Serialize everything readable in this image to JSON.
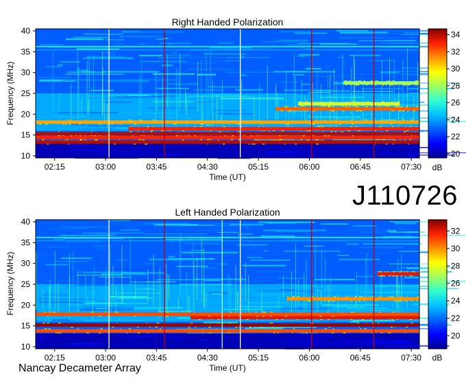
{
  "observation_id": "J110726",
  "credit": "Nancay Decameter Array",
  "colormap": [
    "#00008f",
    "#0000ff",
    "#0060ff",
    "#00c0ff",
    "#30ffd0",
    "#a0ff60",
    "#ffff00",
    "#ff9000",
    "#ff2000",
    "#800000"
  ],
  "chart_data": [
    {
      "type": "heatmap",
      "title": "Right Handed Polarization",
      "xlabel": "Time (UT)",
      "ylabel": "Frequency (MHz)",
      "x_ticks": [
        "02:15",
        "03:00",
        "03:45",
        "04:30",
        "05:15",
        "06:00",
        "06:45",
        "07:30"
      ],
      "x_tick_hours": [
        2.25,
        3.0,
        3.75,
        4.5,
        5.25,
        6.0,
        6.75,
        7.5
      ],
      "xlim_hours": [
        1.97,
        7.62
      ],
      "y_ticks": [
        10,
        15,
        20,
        25,
        30,
        35,
        40
      ],
      "ylim": [
        9.5,
        40.5
      ],
      "colorbar": {
        "unit": "dB",
        "ticks": [
          20,
          22,
          24,
          26,
          28,
          30,
          32,
          34
        ],
        "range": [
          19.5,
          34.7
        ]
      },
      "emission_bands": [
        {
          "freq_mhz": 13.3,
          "start": "01:58",
          "end": "07:37",
          "db": 34
        },
        {
          "freq_mhz": 14.4,
          "start": "01:58",
          "end": "07:37",
          "db": 33
        },
        {
          "freq_mhz": 15.3,
          "start": "01:58",
          "end": "07:37",
          "db": 34
        },
        {
          "freq_mhz": 16.5,
          "start": "03:20",
          "end": "07:37",
          "db": 33
        },
        {
          "freq_mhz": 18.1,
          "start": "01:58",
          "end": "07:37",
          "db": 31
        },
        {
          "freq_mhz": 21.3,
          "start": "05:30",
          "end": "07:37",
          "db": 32
        },
        {
          "freq_mhz": 22.5,
          "start": "05:50",
          "end": "07:20",
          "db": 29
        },
        {
          "freq_mhz": 27.5,
          "start": "06:30",
          "end": "07:37",
          "db": 28
        }
      ],
      "vertical_lines": [
        {
          "time": "03:03",
          "color": "#ffffa0"
        },
        {
          "time": "03:52",
          "color": "#c00000"
        },
        {
          "time": "04:59",
          "color": "#ffffff"
        },
        {
          "time": "06:02",
          "color": "#c00000"
        },
        {
          "time": "06:57",
          "color": "#c00000"
        }
      ]
    },
    {
      "type": "heatmap",
      "title": "Left Handed Polarization",
      "xlabel": "Time (UT)",
      "ylabel": "Frequency (MHz)",
      "x_ticks": [
        "02:15",
        "03:00",
        "03:45",
        "04:30",
        "05:15",
        "06:00",
        "06:45",
        "07:30"
      ],
      "x_tick_hours": [
        2.25,
        3.0,
        3.75,
        4.5,
        5.25,
        6.0,
        6.75,
        7.5
      ],
      "xlim_hours": [
        1.97,
        7.62
      ],
      "y_ticks": [
        10,
        15,
        20,
        25,
        30,
        35,
        40
      ],
      "ylim": [
        9.5,
        40.5
      ],
      "colorbar": {
        "unit": "dB",
        "ticks": [
          20,
          22,
          24,
          26,
          28,
          30,
          32
        ],
        "range": [
          18.5,
          33.3
        ]
      },
      "emission_bands": [
        {
          "freq_mhz": 13.8,
          "start": "01:58",
          "end": "07:37",
          "db": 31
        },
        {
          "freq_mhz": 15.2,
          "start": "01:58",
          "end": "07:37",
          "db": 33
        },
        {
          "freq_mhz": 17.0,
          "start": "04:15",
          "end": "07:37",
          "db": 32
        },
        {
          "freq_mhz": 17.8,
          "start": "01:58",
          "end": "07:37",
          "db": 31
        },
        {
          "freq_mhz": 21.5,
          "start": "05:40",
          "end": "07:37",
          "db": 30
        },
        {
          "freq_mhz": 27.5,
          "start": "07:00",
          "end": "07:37",
          "db": 32
        }
      ],
      "vertical_lines": [
        {
          "time": "03:03",
          "color": "#ffffa0"
        },
        {
          "time": "03:52",
          "color": "#c00000"
        },
        {
          "time": "04:43",
          "color": "#a0ffff"
        },
        {
          "time": "04:59",
          "color": "#ffffff"
        },
        {
          "time": "06:02",
          "color": "#c00000"
        },
        {
          "time": "06:57",
          "color": "#c00000"
        }
      ]
    }
  ]
}
